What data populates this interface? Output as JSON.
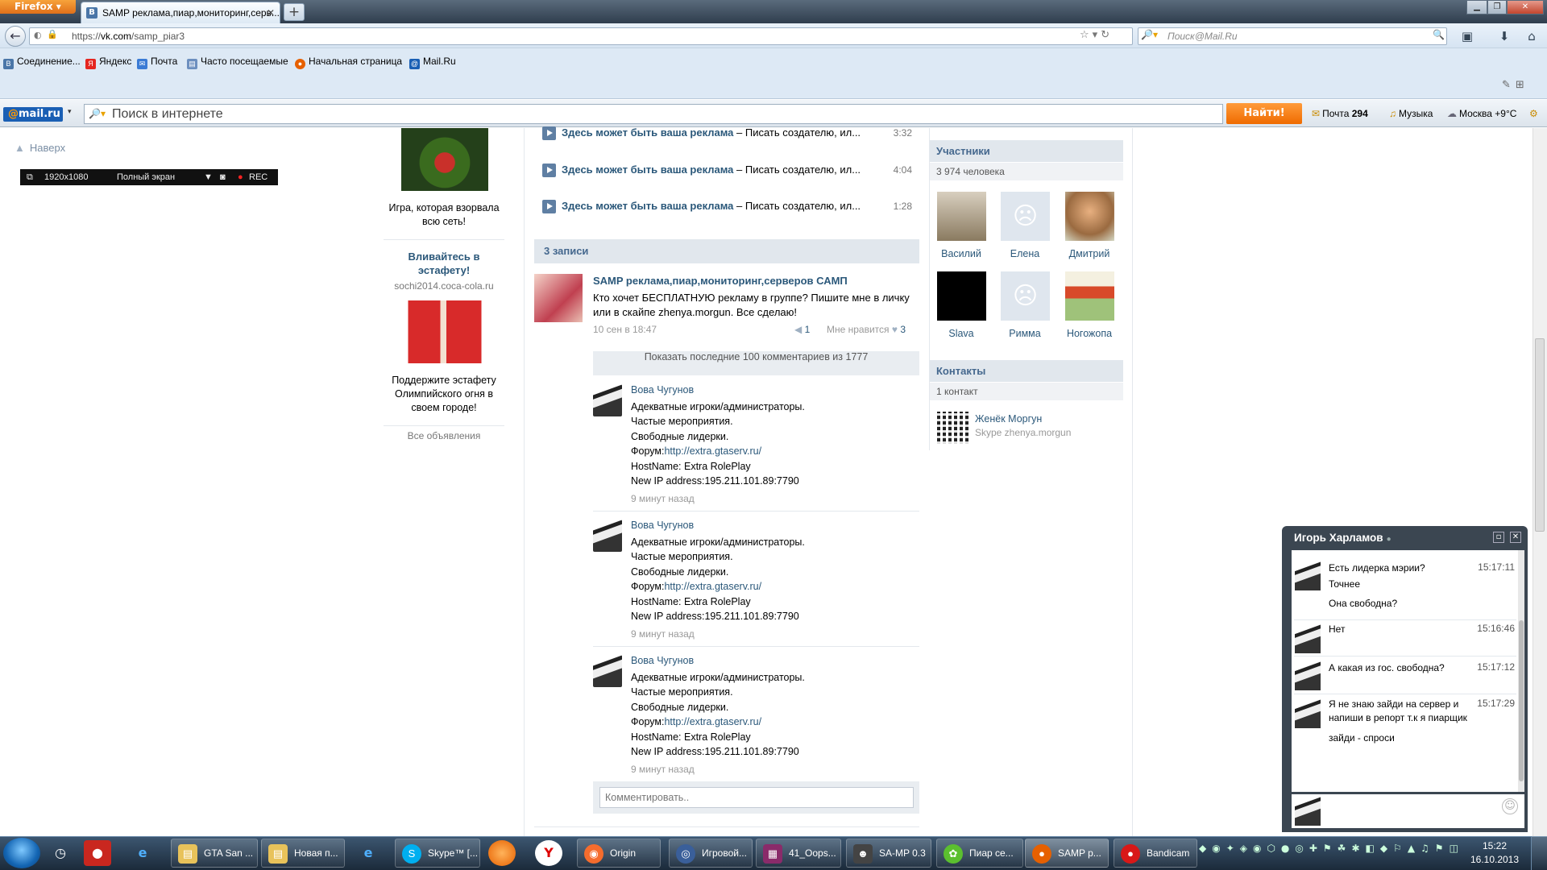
{
  "browser": {
    "app_button": "Firefox",
    "tab_title": "SAMP реклама,пиар,мониторинг,серв...",
    "tab_favicon": "B",
    "new_tab": "+",
    "url_prefix": "https://",
    "url_host": "vk.com",
    "url_path": "/samp_piar3",
    "search_placeholder": "Поиск@Mail.Ru",
    "bookmarks": [
      {
        "label": "Соединение...",
        "icon": "vk-icon",
        "color": "#4a76a8"
      },
      {
        "label": "Яндекс",
        "icon": "yandex-icon",
        "color": "#e52620"
      },
      {
        "label": "Почта",
        "icon": "mail-icon",
        "color": "#3a7bd5"
      },
      {
        "label": "Часто посещаемые",
        "icon": "folder-icon",
        "color": "#6c8fbf"
      },
      {
        "label": "Начальная страница",
        "icon": "firefox-icon",
        "color": "#e66000"
      },
      {
        "label": "Mail.Ru",
        "icon": "mailru-icon",
        "color": "#1a5fb4"
      }
    ]
  },
  "mailbar": {
    "logo_at": "@",
    "logo_text": "mail.ru",
    "search_placeholder": "Поиск в интернете",
    "find_button": "Найти!",
    "mail_label": "Почта",
    "mail_count": "294",
    "music_label": "Музыка",
    "weather": "Москва +9°C"
  },
  "page": {
    "up_link": "Наверх",
    "bandicam": {
      "resolution": "1920x1080",
      "mode": "Полный экран",
      "rec": "REC"
    },
    "ads": {
      "ad1_text": "Игра, которая взорвала всю сеть!",
      "ad2_title": "Вливайтесь в эстафету!",
      "ad2_domain": "sochi2014.coca-cola.ru",
      "ad2_text": "Поддержите эстафету Олимпийского огня в своем городе!",
      "all_ads": "Все объявления"
    },
    "audio": [
      {
        "title": "Здесь может быть ваша реклама",
        "artist": " – Писать создателю, ил...",
        "time": "3:32"
      },
      {
        "title": "Здесь может быть ваша реклама",
        "artist": " – Писать создателю, ил...",
        "time": "4:04"
      },
      {
        "title": "Здесь может быть ваша реклама",
        "artist": " – Писать создателю, ил...",
        "time": "1:28"
      }
    ],
    "wall": {
      "header": "3 записи",
      "post": {
        "author": "SAMP реклама,пиар,мониторинг,серверов САМП",
        "text": "Кто хочет БЕСПЛАТНУЮ рекламу в группе? Пишите мне в личку или в скайпе zhenya.morgun. Все сделаю!",
        "date": "10 сен в 18:47",
        "reposts": "1",
        "like_label": "Мне нравится",
        "likes": "3"
      },
      "show_comments": "Показать последние 100 комментариев из 1777",
      "comments": [
        {
          "author": "Вова Чугунов",
          "lines": [
            "Адекватные игроки/администраторы.",
            "Частые мероприятия.",
            "Свободные лидерки."
          ],
          "forum_label": "Форум:",
          "forum_link": "http://extra.gtaserv.ru/",
          "host": "HostName: Extra RolePlay",
          "ip": "New IP address:195.211.101.89:7790",
          "time": "9 минут назад"
        },
        {
          "author": "Вова Чугунов",
          "lines": [
            "Адекватные игроки/администраторы.",
            "Частые мероприятия.",
            "Свободные лидерки."
          ],
          "forum_label": "Форум:",
          "forum_link": "http://extra.gtaserv.ru/",
          "host": "HostName: Extra RolePlay",
          "ip": "New IP address:195.211.101.89:7790",
          "time": "9 минут назад"
        },
        {
          "author": "Вова Чугунов",
          "lines": [
            "Адекватные игроки/администраторы.",
            "Частые мероприятия.",
            "Свободные лидерки."
          ],
          "forum_label": "Форум:",
          "forum_link": "http://extra.gtaserv.ru/",
          "host": "HostName: Extra RolePlay",
          "ip": "New IP address:195.211.101.89:7790",
          "time": "9 минут назад"
        }
      ],
      "comment_placeholder": "Комментировать.."
    },
    "members": {
      "header": "Участники",
      "count": "3 974 человека",
      "list": [
        {
          "name": "Василий",
          "color": "#b9a78a"
        },
        {
          "name": "Елена",
          "color": "vk-placeholder"
        },
        {
          "name": "Дмитрий",
          "color": "#c88a5a"
        },
        {
          "name": "Slava",
          "color": "#000000"
        },
        {
          "name": "Римма",
          "color": "vk-placeholder"
        },
        {
          "name": "Ногожопа",
          "color": "#d84a2a"
        }
      ]
    },
    "contacts": {
      "header": "Контакты",
      "count": "1 контакт",
      "name": "Женёк Моргун",
      "sub": "Skype zhenya.morgun"
    }
  },
  "chat": {
    "title": "Игорь Харламов",
    "messages": [
      {
        "lines": [
          "Есть лидерка мэрии?",
          "Точнее",
          "Она свободна?"
        ],
        "time": "15:17:11"
      },
      {
        "lines": [
          "Нет"
        ],
        "time": "15:16:46"
      },
      {
        "lines": [
          "А какая из гос. свободна?"
        ],
        "time": "15:17:12"
      },
      {
        "lines": [
          "Я не знаю зайди на сервер и напиши в репорт т.к я пиарщик",
          "зайди - спроси"
        ],
        "time": "15:17:29"
      }
    ]
  },
  "taskbar": {
    "buttons": [
      {
        "label": "GTA San ...",
        "icon": "folder-icon",
        "color": "#e8c25a"
      },
      {
        "label": "Новая п...",
        "icon": "folder-icon",
        "color": "#e8c25a"
      },
      {
        "label": "Skype™ [...",
        "icon": "skype-icon",
        "color": "#00aff0"
      },
      {
        "label": "Origin",
        "icon": "origin-icon",
        "color": "#f56c2d"
      },
      {
        "label": "Игровой...",
        "icon": "game-icon",
        "color": "#3a5f9a"
      },
      {
        "label": "41_Oops...",
        "icon": "winrar-icon",
        "color": "#8a2b6a"
      },
      {
        "label": "SA-MP 0.3",
        "icon": "samp-icon",
        "color": "#444444"
      },
      {
        "label": "Пиар се...",
        "icon": "icq-icon",
        "color": "#5bbf2f"
      },
      {
        "label": "SAMP р...",
        "icon": "firefox-icon",
        "color": "#e66000"
      },
      {
        "label": "Bandicam",
        "icon": "bandicam-icon",
        "color": "#d81818"
      }
    ],
    "clock_time": "15:22",
    "clock_date": "16.10.2013"
  }
}
